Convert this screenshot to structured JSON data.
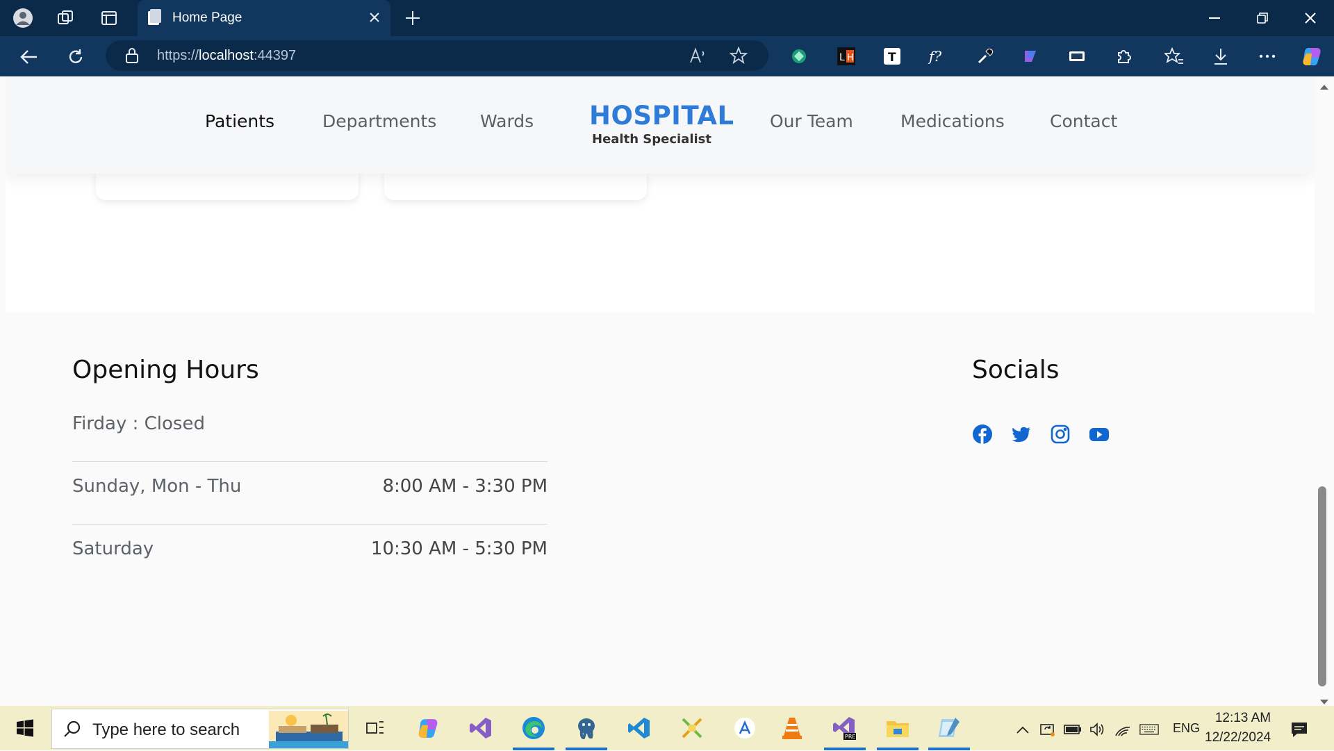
{
  "browser": {
    "tab_title": "Home Page",
    "url_prefix": "https://",
    "url_host": "localhost",
    "url_port": ":44397"
  },
  "site_nav": {
    "left_links": [
      "Patients",
      "Departments",
      "Wards"
    ],
    "right_links": [
      "Our Team",
      "Medications",
      "Contact"
    ],
    "active": "Patients",
    "brand_title": "HOSPITAL",
    "brand_subtitle": "Health Specialist",
    "brand_color": "#2f7bd8"
  },
  "opening_hours": {
    "title": "Opening Hours",
    "rows": [
      {
        "day": "Firday : Closed",
        "time": ""
      },
      {
        "day": "Sunday, Mon - Thu",
        "time": "8:00 AM - 3:30 PM"
      },
      {
        "day": "Saturday",
        "time": "10:30 AM - 5:30 PM"
      }
    ]
  },
  "socials": {
    "title": "Socials",
    "icons": [
      "facebook-icon",
      "twitter-icon",
      "instagram-icon",
      "youtube-icon"
    ],
    "color": "#1266cf"
  },
  "taskbar": {
    "search_placeholder": "Type here to search",
    "language": "ENG",
    "time": "12:13 AM",
    "date": "12/22/2024",
    "bg_color": "#f2eec9"
  }
}
